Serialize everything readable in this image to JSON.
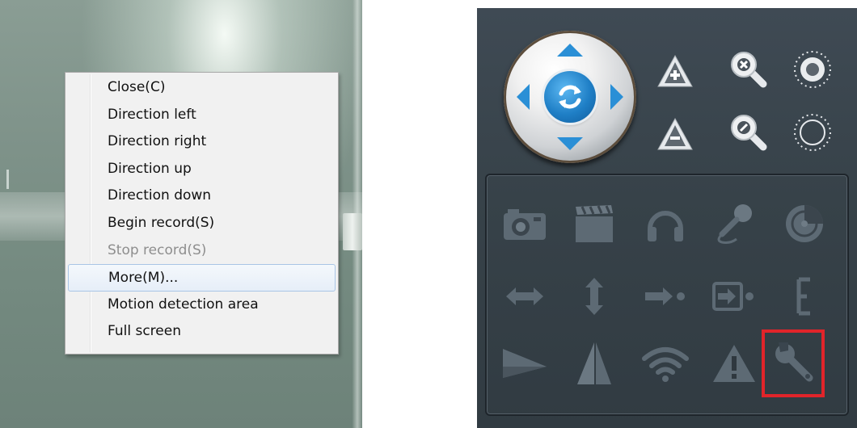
{
  "context_menu": {
    "items": [
      {
        "label": "Close(C)",
        "state": "normal"
      },
      {
        "label": "Direction left",
        "state": "normal"
      },
      {
        "label": "Direction right",
        "state": "normal"
      },
      {
        "label": "Direction up",
        "state": "normal"
      },
      {
        "label": "Direction down",
        "state": "normal"
      },
      {
        "label": "Begin record(S)",
        "state": "normal"
      },
      {
        "label": "Stop record(S)",
        "state": "disabled"
      },
      {
        "label": "More(M)...",
        "state": "hover"
      },
      {
        "label": "Motion detection area",
        "state": "normal"
      },
      {
        "label": "Full screen",
        "state": "normal"
      }
    ]
  },
  "ptz_panel": {
    "joystick": {
      "icon": "refresh-icon",
      "directions": [
        "up",
        "down",
        "left",
        "right"
      ]
    },
    "side_buttons": [
      "focus-plus-icon",
      "zoom-in-icon",
      "iris-open-icon",
      "focus-minus-icon",
      "zoom-out-icon",
      "iris-close-icon"
    ],
    "function_buttons": [
      "camera-icon",
      "video-record-icon",
      "headphones-icon",
      "microphone-icon",
      "radar-icon",
      "horizontal-scan-icon",
      "vertical-scan-icon",
      "preset-goto-icon",
      "preset-set-icon",
      "light-icon",
      "mirror-horizontal-icon",
      "flip-vertical-icon",
      "wifi-icon",
      "alarm-warning-icon",
      "wrench-settings-icon"
    ],
    "highlighted_button": "wrench-settings-icon"
  },
  "colors": {
    "accent_blue": "#2a8fd6",
    "panel_bg": "#3a454e",
    "icon_gray": "#5d6a74",
    "highlight_red": "#e1242a",
    "menu_hover_border": "#a9c5e6"
  }
}
